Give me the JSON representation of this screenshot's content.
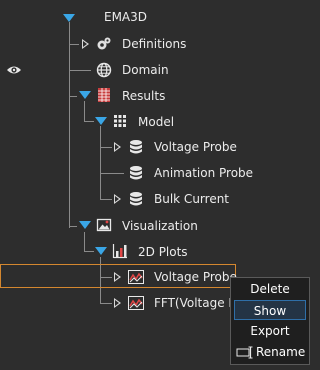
{
  "tree": {
    "root": "EMA3D",
    "definitions": "Definitions",
    "domain": "Domain",
    "results": "Results",
    "model": "Model",
    "voltage_probe": "Voltage Probe",
    "animation_probe": "Animation Probe",
    "bulk_current": "Bulk Current",
    "visualization": "Visualization",
    "plots_2d": "2D Plots",
    "viz_voltage_probe": "Voltage Probe",
    "fft_voltage": "FFT(Voltage Pro"
  },
  "context_menu": {
    "delete": "Delete",
    "show": "Show",
    "export": "Export",
    "rename": "Rename"
  },
  "colors": {
    "background": "#2d2d2d",
    "expand_arrow": "#3aa6e6",
    "selection_border": "#d4872f",
    "menu_bg": "#1f1f1f",
    "menu_hover_border": "#2f6fa8"
  },
  "icons": {
    "visibility": "eye-icon",
    "definitions": "gear-cluster-icon",
    "domain": "globe-icon",
    "results": "table-icon",
    "model": "grid-icon",
    "probe": "database-icon",
    "visualization": "image-icon",
    "plots": "bar-chart-icon",
    "plot_item": "line-chart-icon",
    "rename": "rename-icon"
  }
}
